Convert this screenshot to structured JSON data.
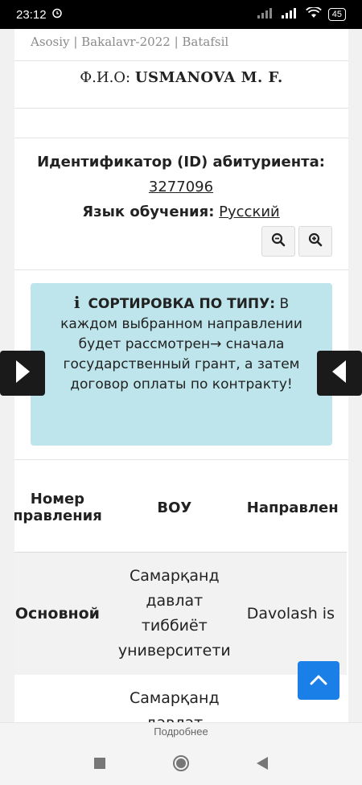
{
  "status_bar": {
    "time": "23:12",
    "battery": "45",
    "icons": [
      "alarm-icon",
      "signal-icon",
      "wifi-icon",
      "battery-icon"
    ]
  },
  "breadcrumb": {
    "items": [
      "Asosiy",
      "Bakalavr-2022",
      "Batafsil"
    ],
    "separator": "|"
  },
  "applicant": {
    "fio_label": "Ф.И.О:",
    "fio_value": "USMANOVA M. F.",
    "id_label": "Идентификатор (ID) абитуриента:",
    "id_value": "3277096",
    "language_label": "Язык обучения:",
    "language_value": "Русский"
  },
  "zoom": {
    "zoom_out": "zoom-out-icon",
    "zoom_in": "zoom-in-icon"
  },
  "alert": {
    "icon": "info-icon",
    "bold_text": "СОРТИРОВКА ПО ТИПУ:",
    "text": " В каждом выбранном направлении будет рассмотрен→ сначала государственный грант, а затем договор оплаты по контракту!"
  },
  "table": {
    "headers": [
      "Номер правления",
      "ВОУ",
      "Направлен"
    ],
    "rows": [
      [
        "Основной",
        "Самарқанд давлат тиббиёт университети",
        "Davolash is"
      ],
      [
        "",
        "Самарқанд давлат",
        ""
      ]
    ]
  },
  "footer": {
    "more_label": "Подробнее"
  },
  "colors": {
    "accent": "#1a80e8",
    "alert_bg": "#bee5eb"
  }
}
